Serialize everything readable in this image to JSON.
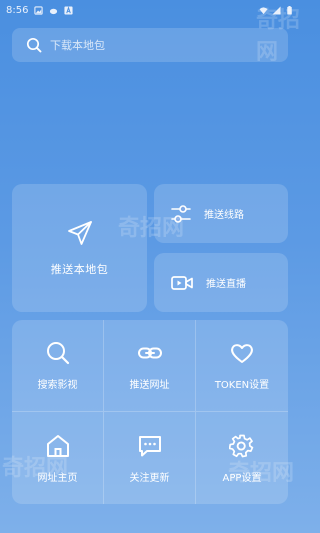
{
  "status_bar": {
    "time": "8:56"
  },
  "search": {
    "placeholder": "下载本地包"
  },
  "cards": {
    "push_local": {
      "label": "推送本地包",
      "icon": "send-icon"
    },
    "push_route": {
      "label": "推送线路",
      "icon": "sliders-icon"
    },
    "push_live": {
      "label": "推送直播",
      "icon": "video-icon"
    }
  },
  "grid": [
    {
      "label": "搜索影视",
      "icon": "search-icon"
    },
    {
      "label": "推送网址",
      "icon": "link-icon"
    },
    {
      "label": "TOKEN设置",
      "icon": "heart-icon"
    },
    {
      "label": "网址主页",
      "icon": "home-icon"
    },
    {
      "label": "关注更新",
      "icon": "message-icon"
    },
    {
      "label": "APP设置",
      "icon": "gear-icon"
    }
  ],
  "watermark": "奇招网"
}
